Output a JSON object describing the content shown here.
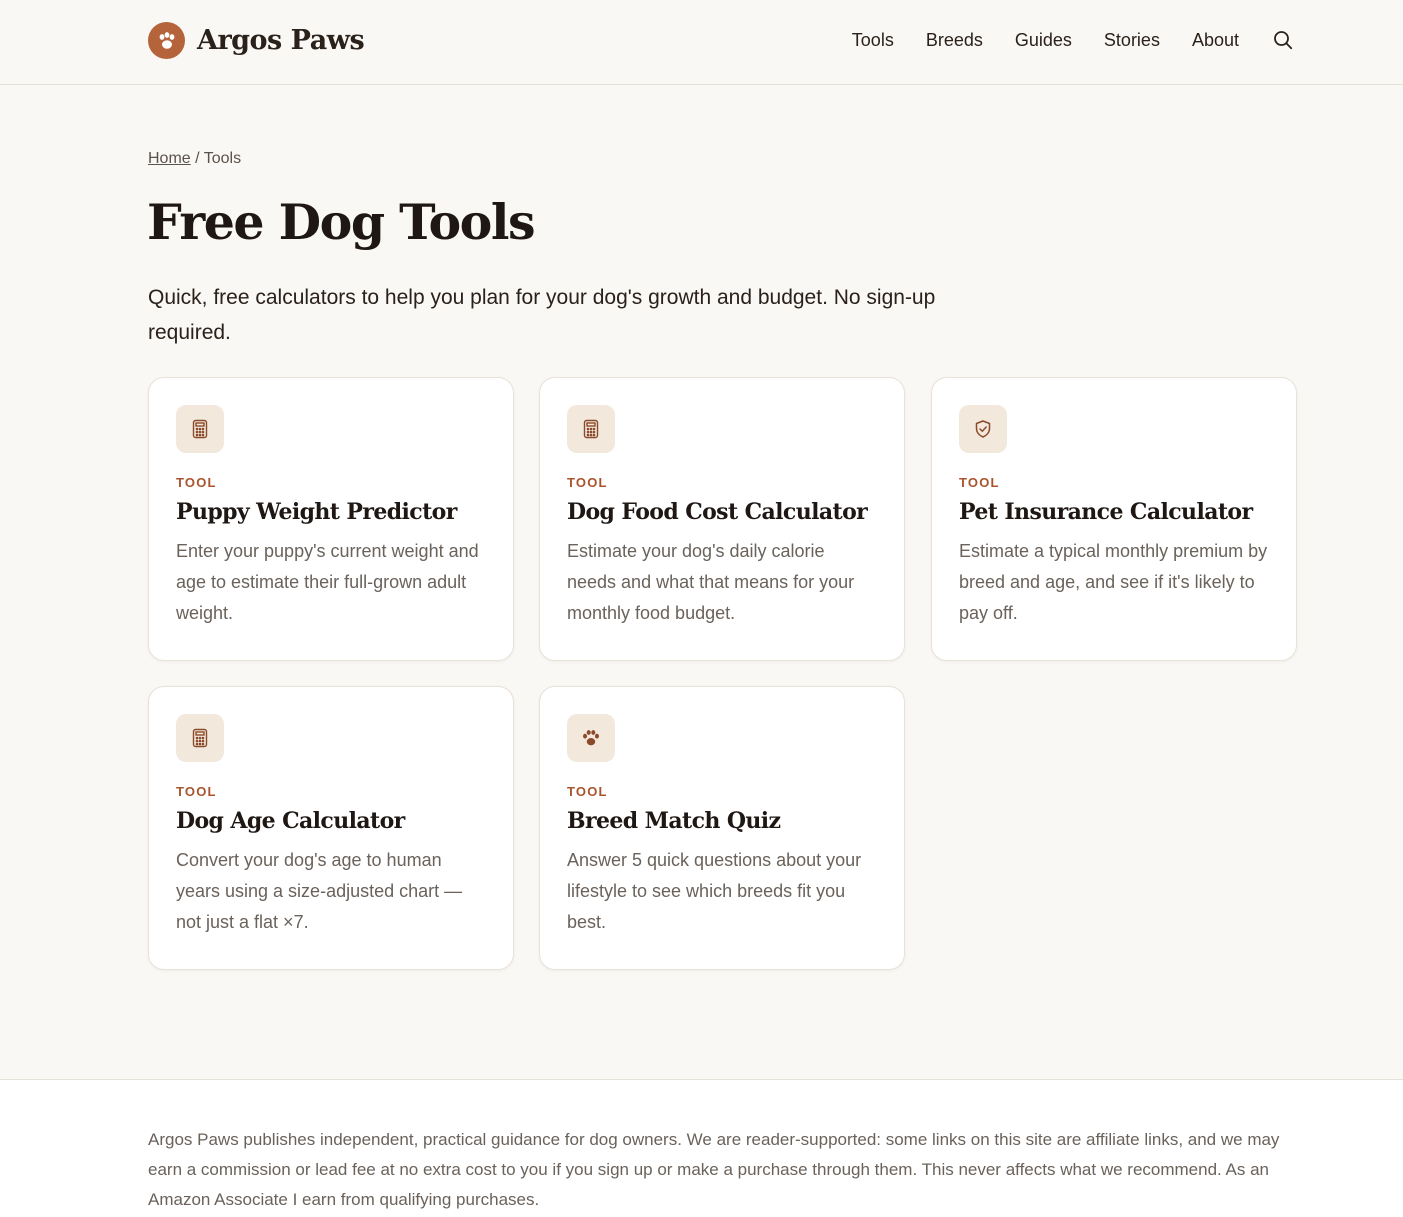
{
  "brand": {
    "name": "Argos Paws",
    "accent": "#b5633a"
  },
  "nav": {
    "items": [
      "Tools",
      "Breeds",
      "Guides",
      "Stories",
      "About"
    ],
    "search_icon": "search-icon"
  },
  "breadcrumb": {
    "home": "Home",
    "separator": "/",
    "current": "Tools"
  },
  "page": {
    "title": "Free Dog Tools",
    "intro": "Quick, free calculators to help you plan for your dog's growth and budget. No sign-up required."
  },
  "cards": [
    {
      "icon": "calculator-icon",
      "tag": "TOOL",
      "title": "Puppy Weight Predictor",
      "desc": "Enter your puppy's current weight and age to estimate their full-grown adult weight."
    },
    {
      "icon": "calculator-icon",
      "tag": "TOOL",
      "title": "Dog Food Cost Calculator",
      "desc": "Estimate your dog's daily calorie needs and what that means for your monthly food budget."
    },
    {
      "icon": "shield-check-icon",
      "tag": "TOOL",
      "title": "Pet Insurance Calculator",
      "desc": "Estimate a typical monthly premium by breed and age, and see if it's likely to pay off."
    },
    {
      "icon": "calculator-icon",
      "tag": "TOOL",
      "title": "Dog Age Calculator",
      "desc": "Convert your dog's age to human years using a size-adjusted chart — not just a flat ×7."
    },
    {
      "icon": "paw-icon",
      "tag": "TOOL",
      "title": "Breed Match Quiz",
      "desc": "Answer 5 quick questions about your lifestyle to see which breeds fit you best."
    }
  ],
  "footer": {
    "disclosure": "Argos Paws publishes independent, practical guidance for dog owners. We are reader-supported: some links on this site are affiliate links, and we may earn a commission or lead fee at no extra cost to you if you sign up or make a purchase through them. This never affects what we recommend. As an Amazon Associate I earn from qualifying purchases."
  }
}
